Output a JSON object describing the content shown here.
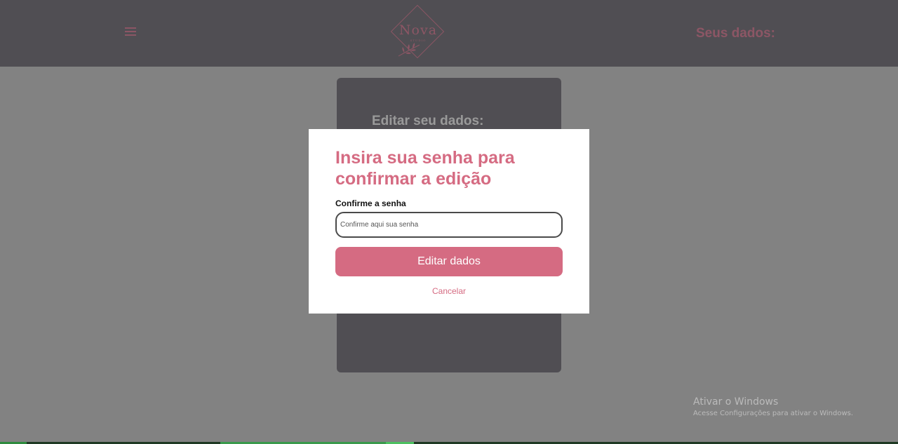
{
  "header": {
    "menu_icon": "hamburger-menu-icon",
    "logo_text": "Nova",
    "logo_subtext": "STUDIO",
    "title": "Seus dados:"
  },
  "card": {
    "title": "Editar seu dados:"
  },
  "modal": {
    "title": "Insira sua senha para confirmar a edição",
    "field_label": "Confirme a senha",
    "field_placeholder": "Confirme aqui sua senha",
    "field_value": "",
    "submit_label": "Editar dados",
    "cancel_label": "Cancelar"
  },
  "watermark": {
    "title": "Ativar o Windows",
    "subtitle": "Acesse Configurações para ativar o Windows."
  },
  "colors": {
    "accent_pink": "#d56b82",
    "header_pink": "#ea8fa8",
    "header_bg": "#86838a",
    "page_bg": "#d9d9d9"
  }
}
